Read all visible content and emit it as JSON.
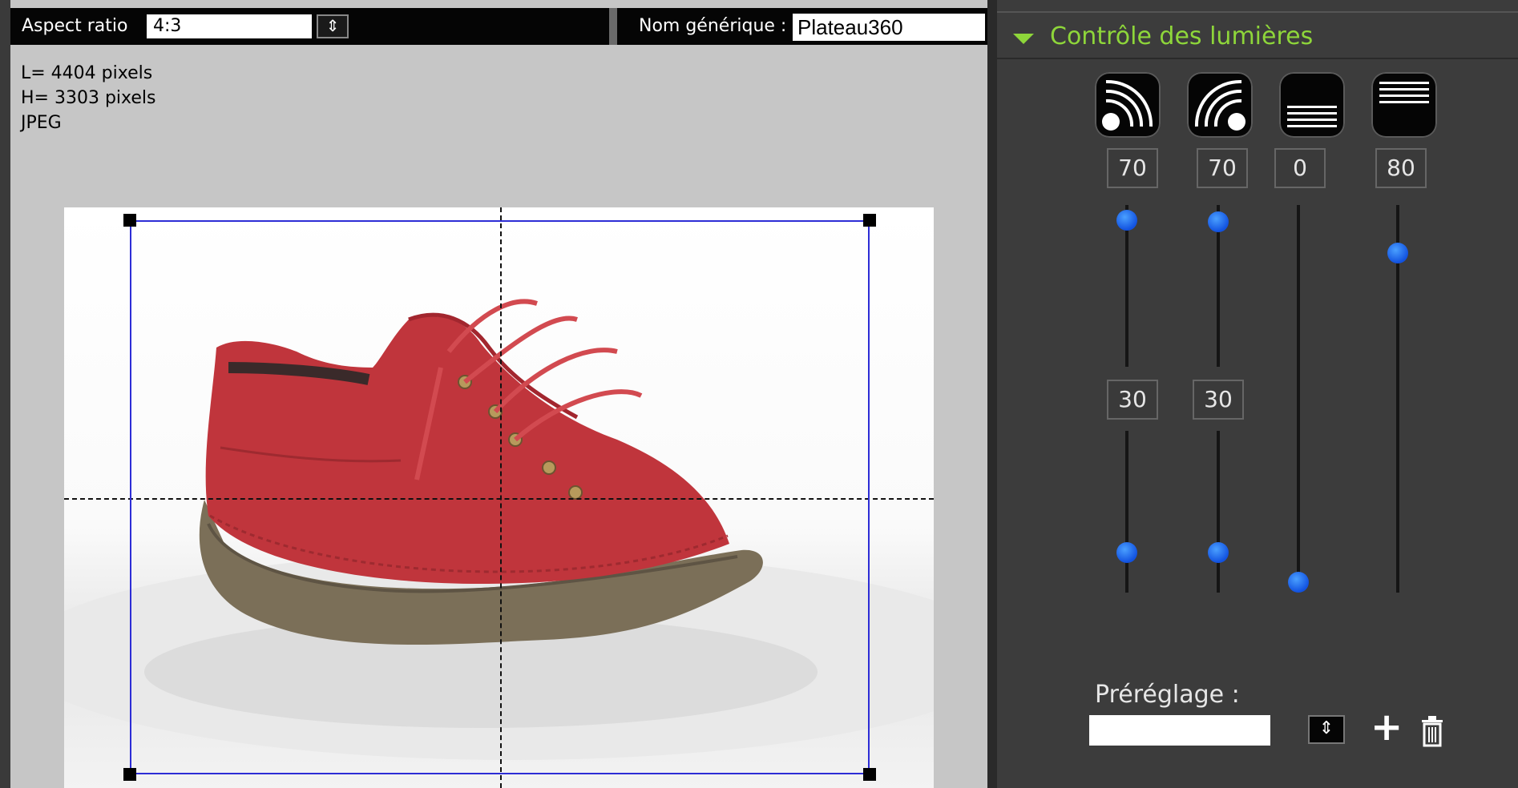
{
  "toolbar": {
    "aspect_ratio_label": "Aspect ratio",
    "aspect_ratio_value": "4:3",
    "generic_name_label": "Nom générique :",
    "generic_name_value": "Plateau360"
  },
  "image_info": {
    "width": "L= 4404 pixels",
    "height": "H= 3303 pixels",
    "format": "JPEG"
  },
  "panel": {
    "title": "Contrôle des lumières",
    "lights": [
      {
        "icon": "light-left-icon",
        "value_top": "70",
        "value_bottom": "30",
        "top_level": 0.7,
        "bottom_level": 0.3
      },
      {
        "icon": "light-right-icon",
        "value_top": "70",
        "value_bottom": "30",
        "top_level": 0.7,
        "bottom_level": 0.3
      },
      {
        "icon": "light-bottom-icon",
        "value_top": "0",
        "top_level": 0.0
      },
      {
        "icon": "light-top-icon",
        "value_top": "80",
        "top_level": 0.8
      }
    ],
    "preset_label": "Préréglage :",
    "preset_value": ""
  },
  "colors": {
    "accent": "#8ed63a",
    "crop_frame": "#2d2dd6",
    "knob": "#1f6bff",
    "shoe": "#c0353c"
  }
}
